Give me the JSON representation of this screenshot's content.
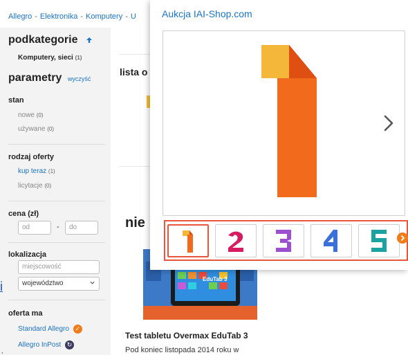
{
  "breadcrumb": {
    "items": [
      "Allegro",
      "Elektronika",
      "Komputery",
      "U"
    ],
    "separator": "-"
  },
  "sidebar": {
    "subcategories_title": "podkategorie",
    "subcategory": {
      "label": "Komputery, sieci",
      "count": "(1)"
    },
    "params_title": "parametry",
    "clear_label": "wyczyść",
    "state_label": "stan",
    "state_options": [
      {
        "label": "nowe",
        "count": "(0)"
      },
      {
        "label": "używane",
        "count": "(0)"
      }
    ],
    "offer_type_label": "rodzaj oferty",
    "offer_type_options": [
      {
        "label": "kup teraz",
        "count": "(1)"
      },
      {
        "label": "licytacje",
        "count": "(0)"
      }
    ],
    "price_label": "cena (zł)",
    "price_from_placeholder": "od",
    "price_to_placeholder": "do",
    "price_dash": "-",
    "location_label": "lokalizacja",
    "city_placeholder": "miejscowość",
    "region_value": "województwo",
    "offer_label": "oferta ma",
    "offer_options": [
      {
        "label": "Standard Allegro",
        "badge_color": "#f07c1a"
      },
      {
        "label": "Allegro InPost",
        "badge_color": "#3c3a5e"
      }
    ]
  },
  "main": {
    "heading_partial": "lista o",
    "heading2_partial": "nie",
    "article_title": "Test tabletu Overmax EduTab 3",
    "article_text": "Pod koniec listopada 2014 roku w",
    "tablet_label": "EduTab 3",
    "left_letter": "i",
    "left_comma": ","
  },
  "gallery": {
    "title": "Aukcja IAI-Shop.com",
    "next_icon": "chevron-right-icon",
    "thumbnails": [
      "1",
      "2",
      "3",
      "4",
      "5"
    ],
    "active_index": 0,
    "accent_color": "#e8553a"
  }
}
